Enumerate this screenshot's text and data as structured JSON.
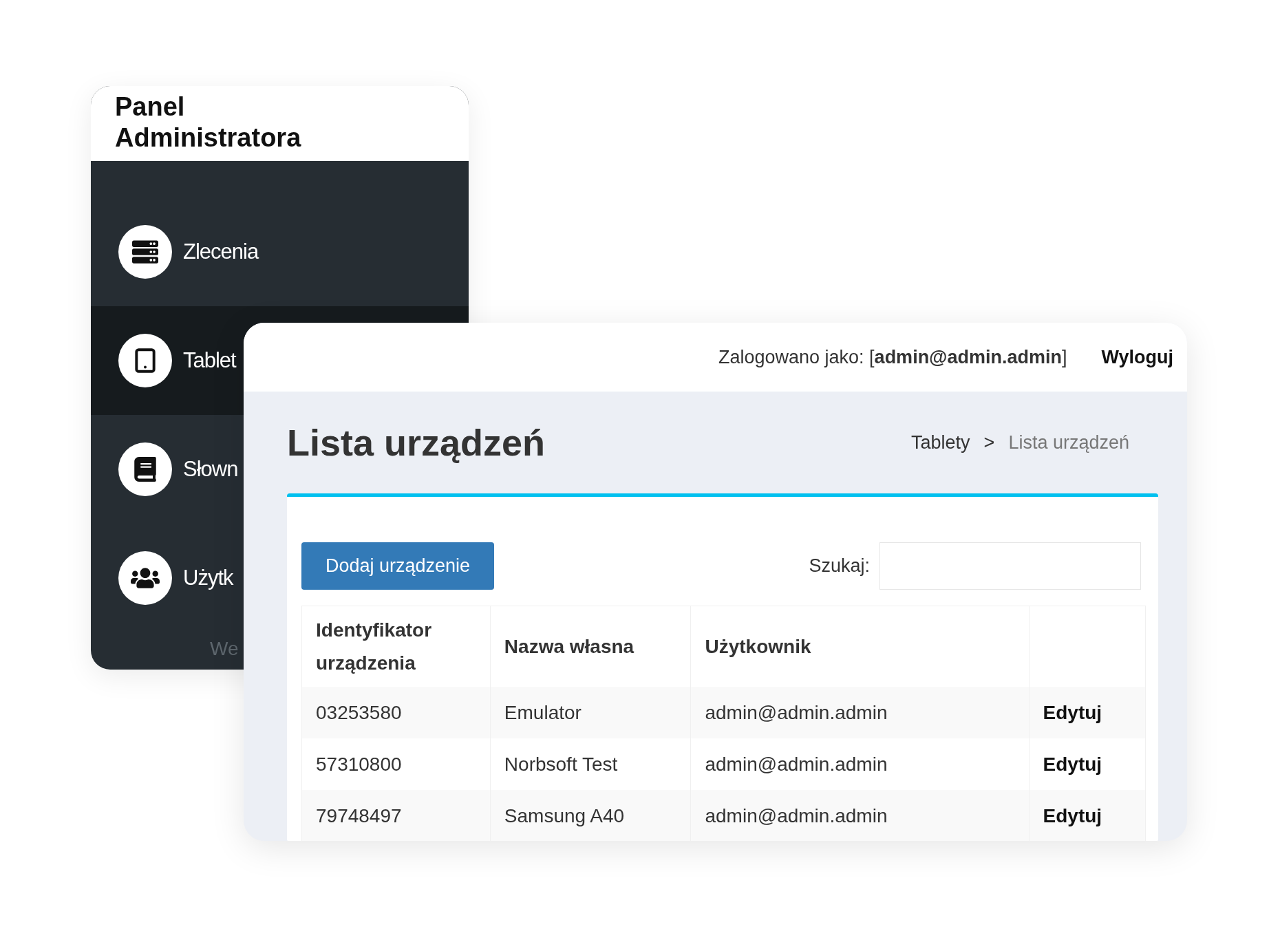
{
  "sidebar": {
    "title": "Panel Administratora",
    "items": [
      {
        "label": "Zlecenia",
        "selected": false
      },
      {
        "label": "Tablet",
        "selected": true
      },
      {
        "label": "Słown",
        "selected": false
      },
      {
        "label": "Użytk",
        "selected": false
      }
    ],
    "footer": "We"
  },
  "main": {
    "header": {
      "login": "Zalogowano jako: [**admin@admin.admin**]",
      "logout": "Wyloguj"
    },
    "page_title": "Lista urządzeń",
    "breadcrumb": {
      "items": [
        "Tablety",
        "Lista urządzeń"
      ],
      "separator": ">"
    },
    "add_button": "Dodaj urządzenie",
    "search": {
      "label": "Szukaj:"
    },
    "table": {
      "columns": [
        "Identyfikator urządzenia",
        "Nazwa własna",
        "Użytkownik",
        ""
      ],
      "rows": [
        {
          "id": "03253580",
          "name": "Emulator",
          "user": "admin@admin.admin",
          "action": "Edytuj"
        },
        {
          "id": "57310800",
          "name": "Norbsoft Test",
          "user": "admin@admin.admin",
          "action": "Edytuj"
        },
        {
          "id": "79748497",
          "name": "Samsung A40",
          "user": "admin@admin.admin",
          "action": "Edytuj"
        }
      ]
    }
  }
}
